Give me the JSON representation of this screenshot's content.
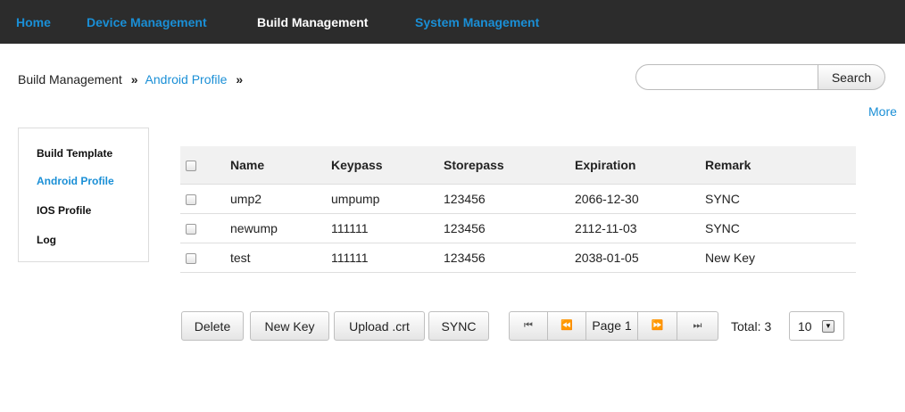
{
  "nav": {
    "items": [
      {
        "label": "Home"
      },
      {
        "label": "Device Management"
      },
      {
        "label": "Build Management"
      },
      {
        "label": "System Management"
      }
    ],
    "active": "Build Management"
  },
  "breadcrumb": {
    "root": "Build Management",
    "separator": "»",
    "current": "Android Profile"
  },
  "search": {
    "value": "",
    "placeholder": "",
    "button_label": "Search",
    "more_label": "More"
  },
  "sidebar": {
    "items": [
      {
        "label": "Build Template"
      },
      {
        "label": "Android Profile"
      },
      {
        "label": "IOS Profile"
      },
      {
        "label": "Log"
      }
    ],
    "active": "Android Profile"
  },
  "table": {
    "columns": [
      "Name",
      "Keypass",
      "Storepass",
      "Expiration",
      "Remark"
    ],
    "rows": [
      [
        "ump2",
        "umpump",
        "123456",
        "2066-12-30",
        "SYNC"
      ],
      [
        "newump",
        "111111",
        "123456",
        "2112-11-03",
        "SYNC"
      ],
      [
        "test",
        "111111",
        "123456",
        "2038-01-05",
        "New Key"
      ]
    ]
  },
  "toolbar": {
    "delete_label": "Delete",
    "new_key_label": "New Key",
    "upload_label": "Upload .crt",
    "sync_label": "SYNC"
  },
  "pagination": {
    "first_icon": "first-page-icon",
    "prev_icon": "previous-page-icon",
    "current_label": "Page 1",
    "next_icon": "next-page-icon",
    "last_icon": "last-page-icon",
    "total_label": "Total:",
    "total_count": "3",
    "page_size": "10"
  },
  "colors": {
    "nav_background": "#2c2c2c",
    "link_blue": "#1a8fd6",
    "header_row": "#f1f1f1"
  }
}
